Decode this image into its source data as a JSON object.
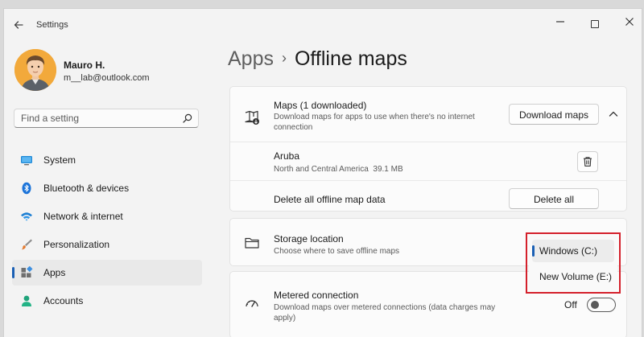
{
  "window": {
    "title": "Settings"
  },
  "user": {
    "name": "Mauro H.",
    "email": "m__lab@outlook.com"
  },
  "search": {
    "placeholder": "Find a setting"
  },
  "nav": {
    "items": [
      {
        "label": "System",
        "icon": "monitor-icon"
      },
      {
        "label": "Bluetooth & devices",
        "icon": "bluetooth-icon"
      },
      {
        "label": "Network & internet",
        "icon": "wifi-icon"
      },
      {
        "label": "Personalization",
        "icon": "paintbrush-icon"
      },
      {
        "label": "Apps",
        "icon": "apps-icon",
        "selected": true
      },
      {
        "label": "Accounts",
        "icon": "person-icon"
      }
    ]
  },
  "breadcrumb": {
    "parent": "Apps",
    "separator": "›",
    "current": "Offline maps"
  },
  "maps": {
    "title": "Maps (1 downloaded)",
    "description": "Download maps for apps to use when there's no internet connection",
    "download_label": "Download maps",
    "entries": [
      {
        "name": "Aruba",
        "region": "North and Central America",
        "size": "39.1 MB"
      }
    ],
    "delete_all_text": "Delete all offline map data",
    "delete_all_label": "Delete all"
  },
  "storage": {
    "title": "Storage location",
    "description": "Choose where to save offline maps",
    "options": [
      {
        "label": "Windows (C:)",
        "selected": true
      },
      {
        "label": "New Volume (E:)",
        "selected": false
      }
    ]
  },
  "metered": {
    "title": "Metered connection",
    "description": "Download maps over metered connections (data charges may apply)",
    "toggle_label": "Off",
    "toggle_on": false
  },
  "colors": {
    "accent": "#1a5fb4",
    "highlight": "#d4202b",
    "avatar_bg": "#f2a93b"
  }
}
